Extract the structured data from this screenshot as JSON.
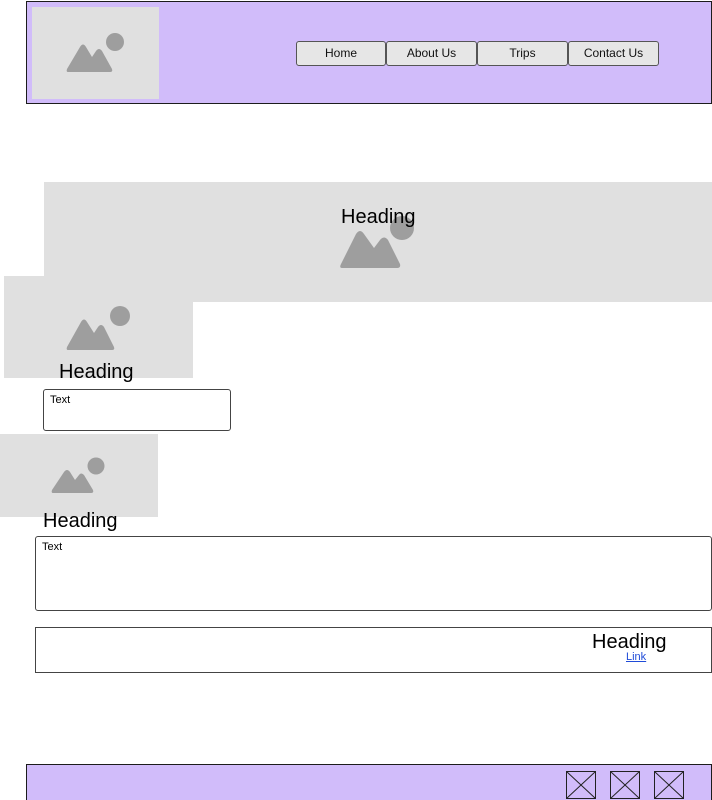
{
  "header": {
    "logo_icon": "image-placeholder-icon",
    "nav": [
      {
        "label": "Home"
      },
      {
        "label": "About Us"
      },
      {
        "label": "Trips"
      },
      {
        "label": "Contact Us"
      }
    ]
  },
  "hero": {
    "heading": "Heading",
    "image_icon": "image-placeholder-icon"
  },
  "section_one": {
    "heading": "Heading",
    "text": "Text",
    "image_icon": "image-placeholder-icon"
  },
  "section_two": {
    "heading": "Heading",
    "text": "Text",
    "image_icon": "image-placeholder-icon"
  },
  "callout": {
    "heading": "Heading",
    "link": "Link"
  },
  "footer": {
    "icons": [
      "x-box-icon",
      "x-box-icon",
      "x-box-icon"
    ]
  },
  "colors": {
    "header_bg": "#d1bcfa",
    "placeholder_bg": "#e0e0e0",
    "placeholder_glyph": "#9e9e9e",
    "link": "#1f4bd8"
  }
}
